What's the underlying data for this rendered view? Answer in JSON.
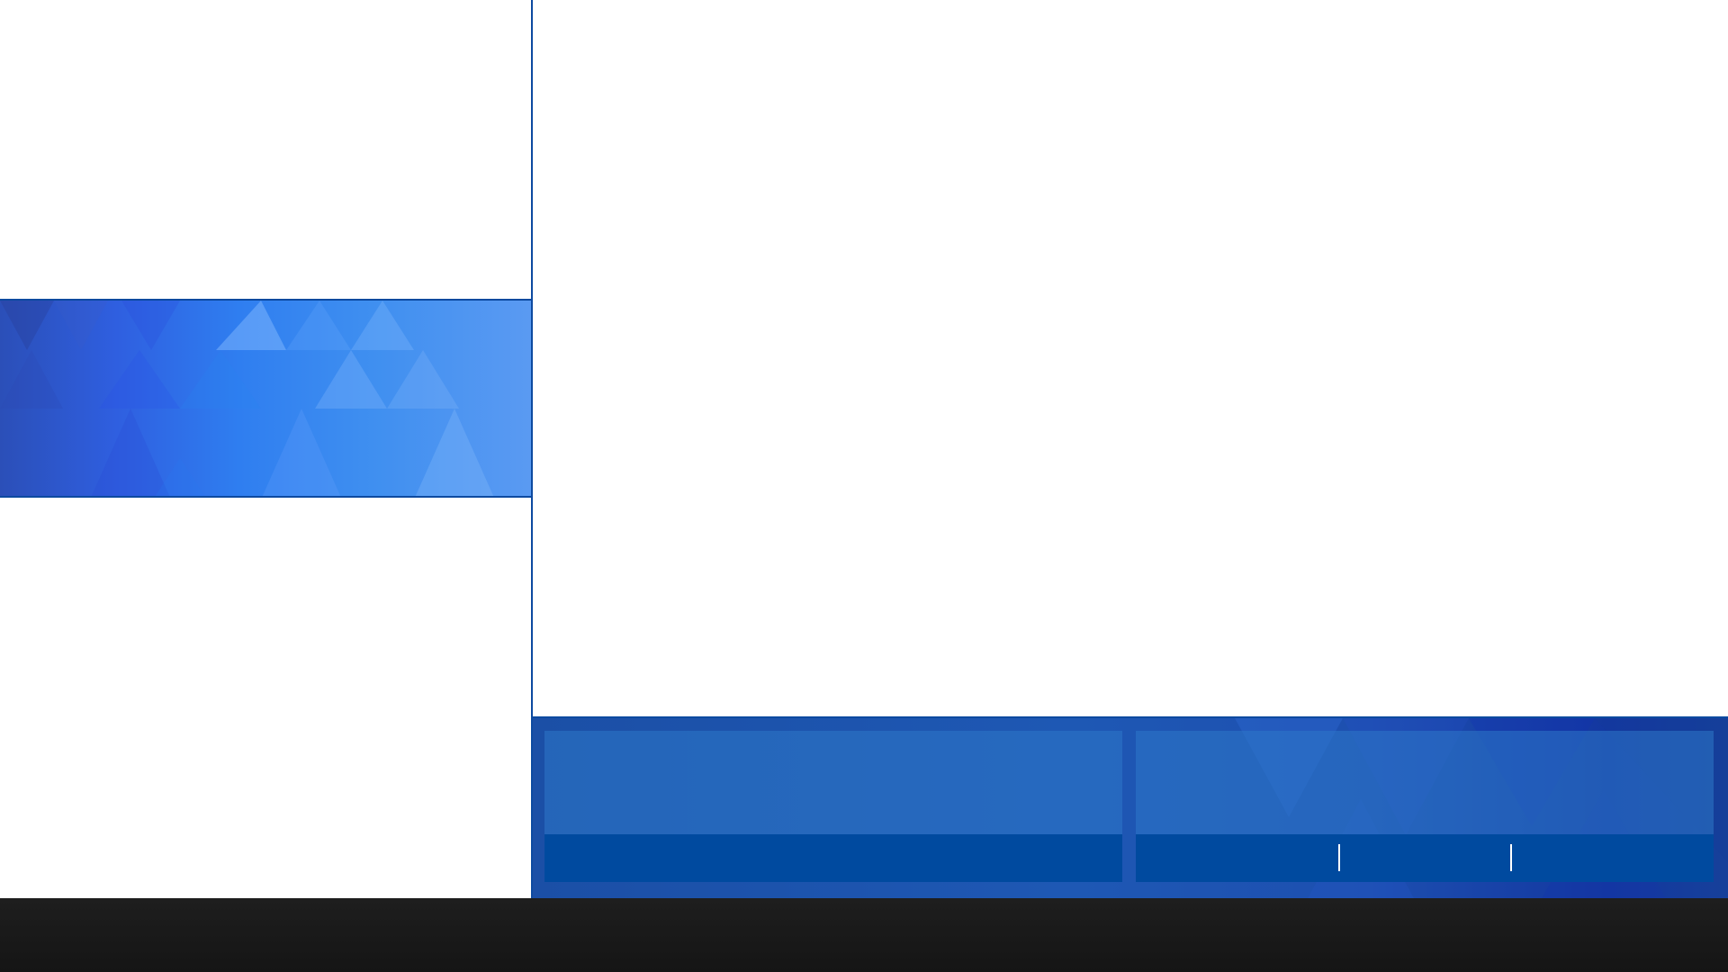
{
  "window": {
    "left_panel": {
      "banner": {
        "description_visible_text": ""
      }
    },
    "action_area": {
      "tiles": [
        {
          "label": ""
        },
        {
          "label": ""
        }
      ]
    }
  },
  "taskbar": {
    "items": []
  },
  "colors": {
    "accent": "#0d4aa0",
    "banner_light": "#5a9af2",
    "banner_dark": "#2b4fb8",
    "tile_bar": "#004a9f",
    "taskbar": "#1a1a1a"
  }
}
